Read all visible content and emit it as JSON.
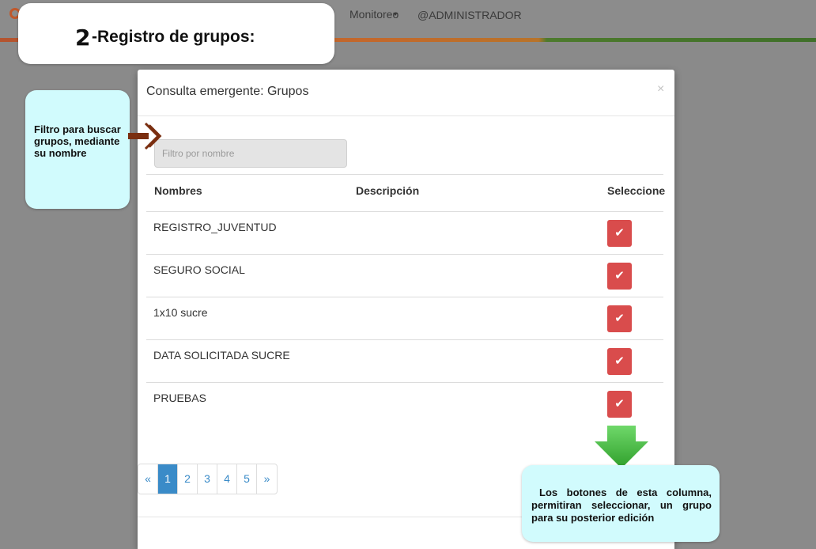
{
  "navbar": {
    "monitoreo_label": "Monitoreo",
    "user_label": "@ADMINISTRADOR",
    "logo_icon": "location-pin-icon",
    "colors": {
      "accent_orange": "#c3682c",
      "accent_green": "#4d7a2d"
    }
  },
  "title_callout": {
    "number": "2",
    "text": "-Registro de grupos:"
  },
  "modal": {
    "title": "Consulta emergente: Grupos",
    "close_label": "×",
    "filter": {
      "placeholder": "Filtro por nombre",
      "value": ""
    },
    "columns": {
      "name": "Nombres",
      "description": "Descripción",
      "select": "Seleccione"
    },
    "rows": [
      {
        "name": "REGISTRO_JUVENTUD",
        "description": ""
      },
      {
        "name": "SEGURO SOCIAL",
        "description": ""
      },
      {
        "name": "1x10 sucre",
        "description": ""
      },
      {
        "name": "DATA SOLICITADA SUCRE",
        "description": ""
      },
      {
        "name": "PRUEBAS",
        "description": ""
      }
    ],
    "select_icon": "check-icon",
    "select_glyph": "✔",
    "select_color": "#d94c4c",
    "pagination": {
      "prev": "«",
      "pages": [
        "1",
        "2",
        "3",
        "4",
        "5"
      ],
      "next": "»",
      "active_page": "1"
    }
  },
  "annotations": {
    "filter_callout": "Filtro para buscar grupos, mediante su nombre",
    "help_callout": "Los botones de esta columna, permitiran seleccionar, un grupo para su posterior edición",
    "callout_color": "#d1fbfd"
  }
}
